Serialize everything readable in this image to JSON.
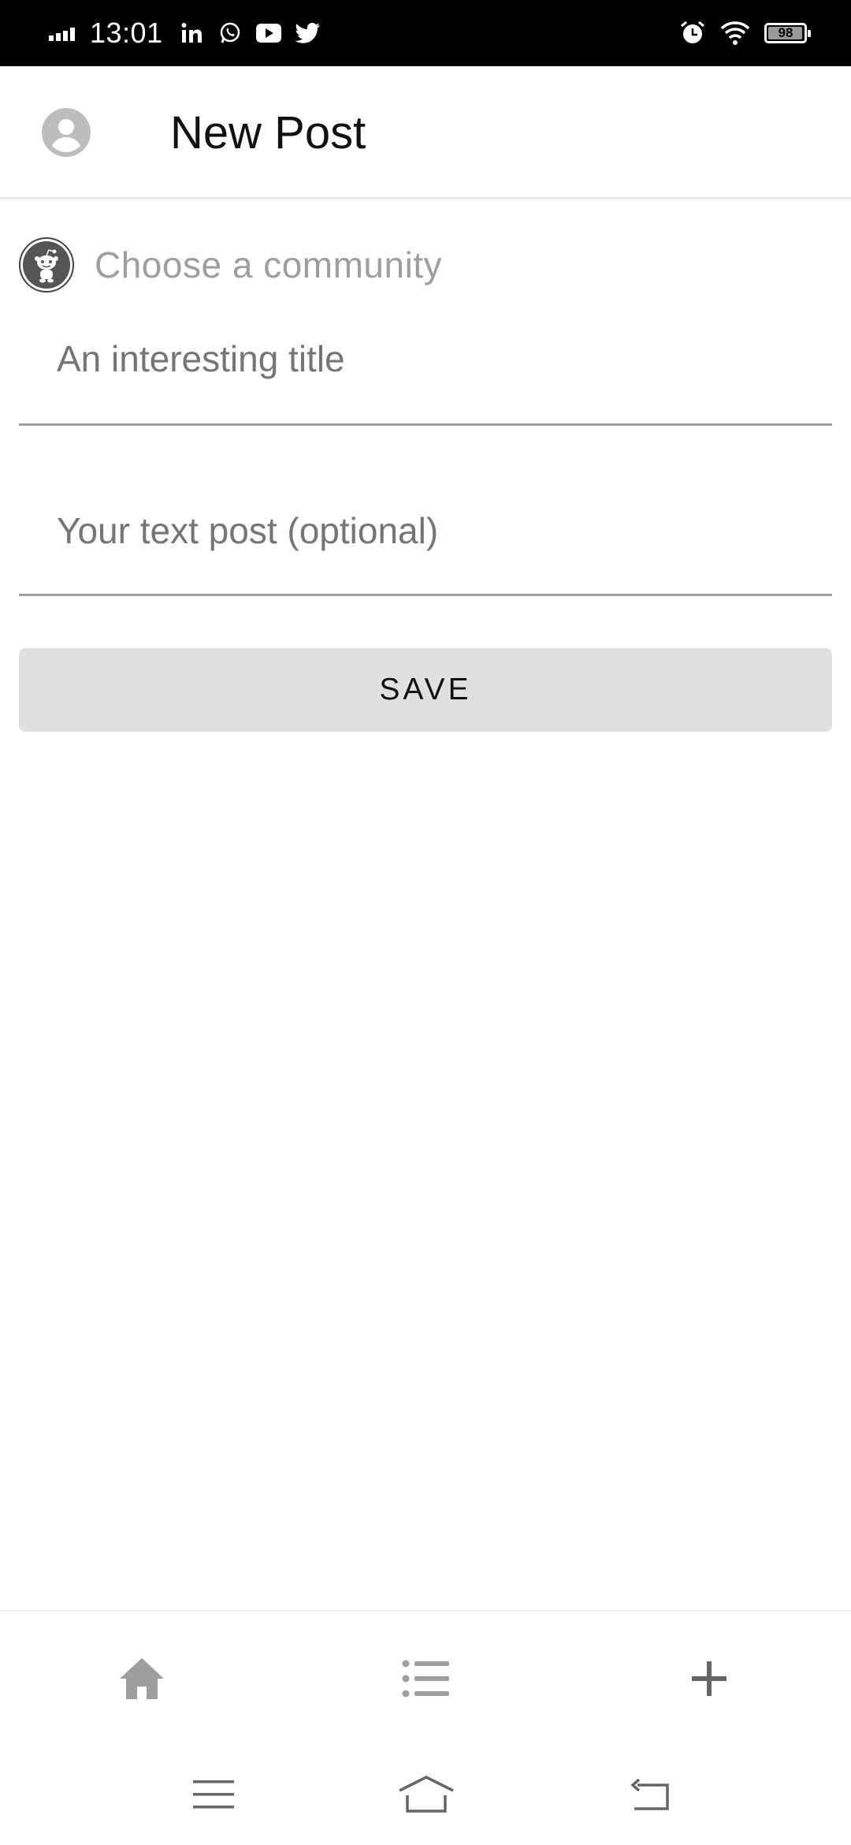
{
  "status_bar": {
    "time": "13:01",
    "battery_level": "98",
    "battery_percent": 98,
    "notification_icons": [
      "signal-icon",
      "linkedin-icon",
      "whatsapp-icon",
      "youtube-icon",
      "twitter-icon"
    ],
    "system_icons": [
      "alarm-icon",
      "wifi-icon",
      "battery-icon"
    ]
  },
  "header": {
    "title": "New Post",
    "avatar_icon": "account-circle-icon"
  },
  "form": {
    "community_placeholder": "Choose a community",
    "community_icon": "reddit-snoo-icon",
    "title_placeholder": "An interesting title",
    "title_value": "",
    "body_placeholder": "Your text post (optional)",
    "body_value": "",
    "save_label": "SAVE"
  },
  "bottom_nav": {
    "items": [
      "home-icon",
      "list-icon",
      "add-icon"
    ]
  },
  "system_nav": {
    "items": [
      "menu-icon",
      "home-outline-icon",
      "back-icon"
    ]
  },
  "colors": {
    "status_bar": "#000000",
    "background": "#ffffff",
    "placeholder": "#9e9e9e",
    "button_bg": "#e0e0e0",
    "icon_gray": "#9e9e9e"
  }
}
